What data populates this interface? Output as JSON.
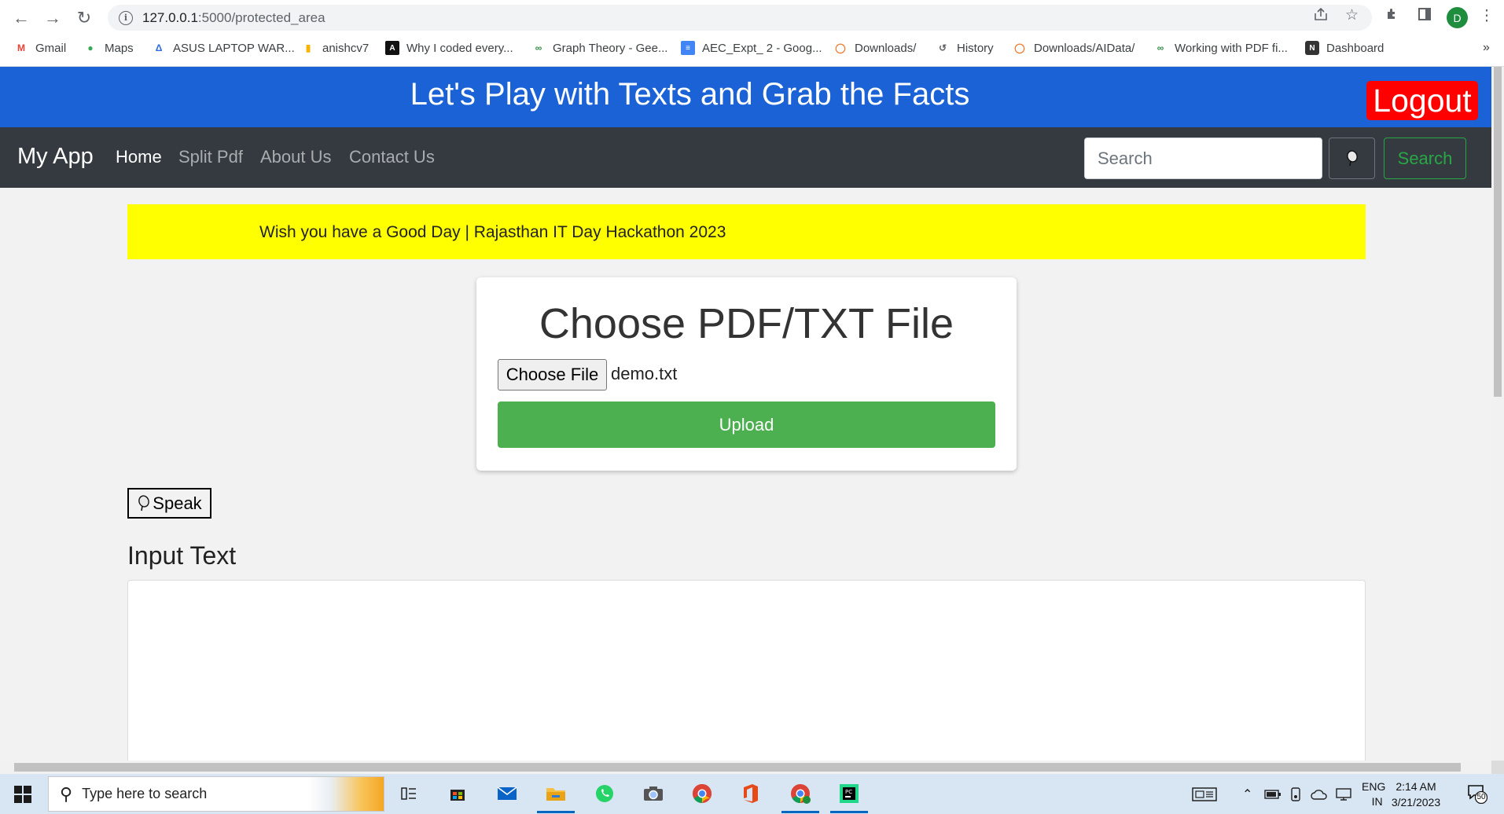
{
  "browser": {
    "url_host": "127.0.0.1",
    "url_path": ":5000/protected_area",
    "profile_initial": "D",
    "bookmarks": [
      {
        "label": "Gmail",
        "icon": "gmail-icon"
      },
      {
        "label": "Maps",
        "icon": "maps-icon"
      },
      {
        "label": "ASUS LAPTOP WAR...",
        "icon": "asus-icon"
      },
      {
        "label": "anishcv7",
        "icon": "analytics-icon"
      },
      {
        "label": "Why I coded every...",
        "icon": "blog-icon"
      },
      {
        "label": "Graph Theory - Gee...",
        "icon": "gfg-icon"
      },
      {
        "label": "AEC_Expt_ 2 - Goog...",
        "icon": "docs-icon"
      },
      {
        "label": "Downloads/",
        "icon": "jupyter-icon"
      },
      {
        "label": "History",
        "icon": "history-icon"
      },
      {
        "label": "Downloads/AIData/",
        "icon": "jupyter-icon"
      },
      {
        "label": "Working with PDF fi...",
        "icon": "gfg-icon"
      },
      {
        "label": "Dashboard",
        "icon": "dashboard-icon"
      }
    ],
    "overflow": "»"
  },
  "header": {
    "title": "Let's Play with Texts and Grab the Facts",
    "logout_label": "Logout"
  },
  "navbar": {
    "brand": "My App",
    "links": [
      "Home",
      "Split Pdf",
      "About Us",
      "Contact Us"
    ],
    "active": "Home",
    "search_placeholder": "Search",
    "search_button": "Search"
  },
  "banner": {
    "text": "Wish you have a Good Day | Rajasthan IT Day Hackathon 2023"
  },
  "upload": {
    "title": "Choose PDF/TXT File",
    "choose_label": "Choose File",
    "file_name": "demo.txt",
    "upload_label": "Upload"
  },
  "speak": {
    "label": "Speak"
  },
  "input_section": {
    "label": "Input Text",
    "value": ""
  },
  "taskbar": {
    "search_placeholder": "Type here to search",
    "language": "ENG",
    "region": "IN",
    "time": "2:14 AM",
    "date": "3/21/2023",
    "notification_count": "50"
  },
  "colors": {
    "hero_bg": "#1a62d6",
    "logout_bg": "#ff0000",
    "navbar_bg": "#343a40",
    "banner_bg": "#ffff00",
    "upload_bg": "#4caf50",
    "search_outline": "#28a745"
  }
}
